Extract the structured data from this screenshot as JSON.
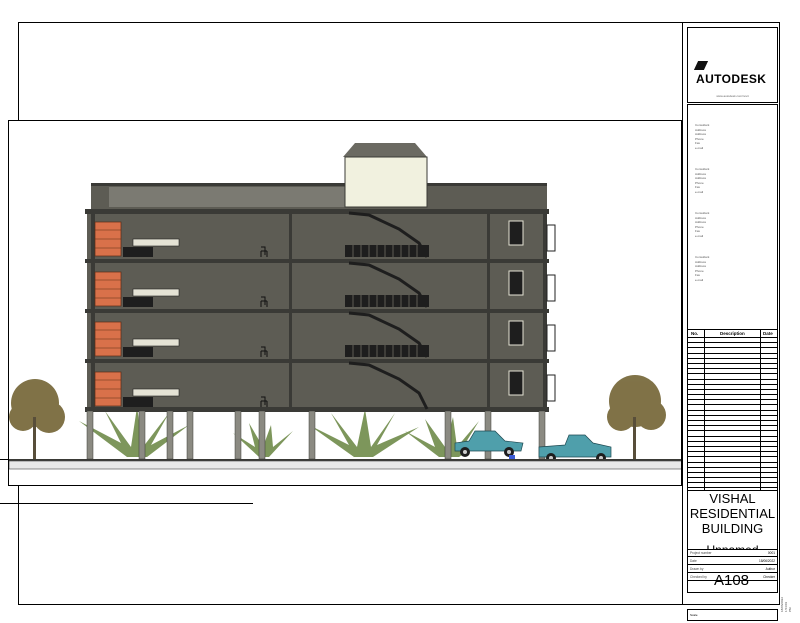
{
  "titleblock": {
    "logo_text": "AUTODESK",
    "logo_url": "www.autodesk.com/revit",
    "consultants": [
      [
        "Consultant",
        "Address",
        "Address",
        "Phone",
        "Fax",
        "e-mail"
      ],
      [
        "Consultant",
        "Address",
        "Address",
        "Phone",
        "Fax",
        "e-mail"
      ],
      [
        "Consultant",
        "Address",
        "Address",
        "Phone",
        "Fax",
        "e-mail"
      ],
      [
        "Consultant",
        "Address",
        "Address",
        "Phone",
        "Fax",
        "e-mail"
      ]
    ],
    "revision_headers": {
      "no": "No.",
      "description": "Description",
      "date": "Date"
    },
    "project_name_line1": "VISHAL",
    "project_name_line2": "RESIDENTIAL",
    "project_name_line3": "BUILDING",
    "sheet_name": "Unnamed",
    "info": [
      {
        "key": "Project number",
        "value": "0001"
      },
      {
        "key": "Date",
        "value": "18/06/2022"
      },
      {
        "key": "Drawn by",
        "value": "Author"
      },
      {
        "key": "Checked by",
        "value": "Checker"
      }
    ],
    "sheet_number": "A108",
    "scale_label": "Scale",
    "side_note": "18/06/2022 1:54:09 PM"
  },
  "colors": {
    "wall": "#5d5c54",
    "slab": "#3a3a36",
    "shelf": "#d9714a",
    "stair": "#1e1e1e",
    "car": "#4f9fab",
    "tree": "#6a5a28",
    "palm": "#6f8b4a"
  },
  "drawing": {
    "floors": 4,
    "view": "section"
  }
}
